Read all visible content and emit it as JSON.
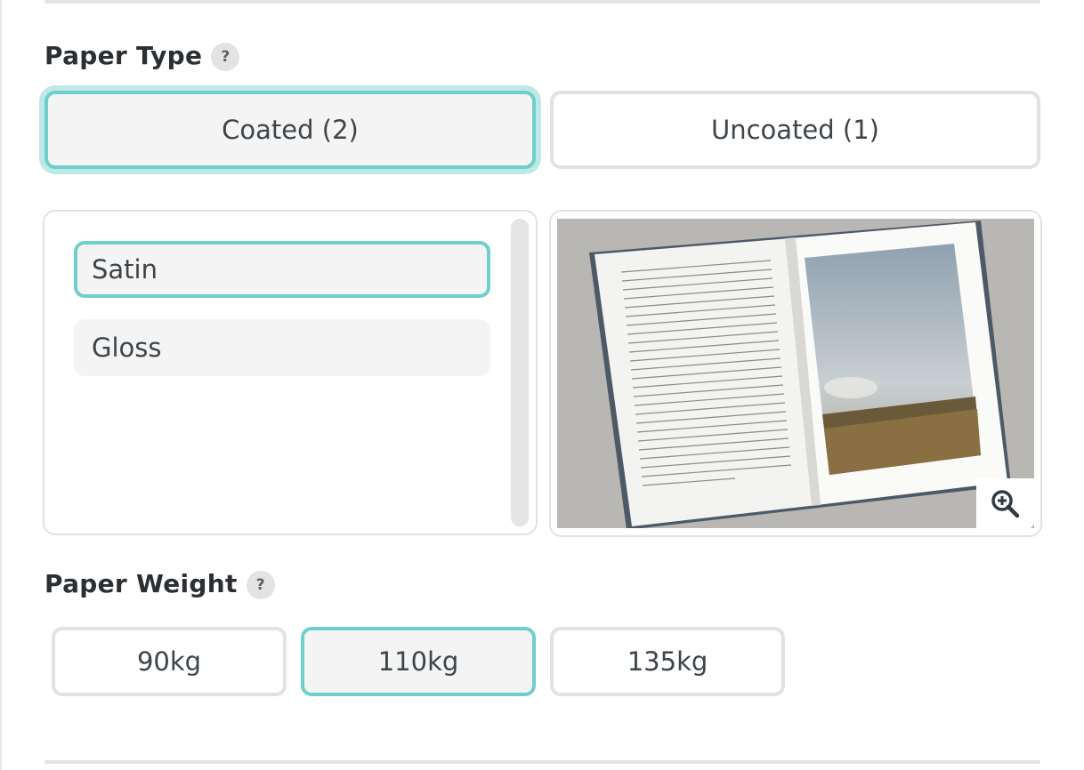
{
  "paper_type": {
    "title": "Paper Type",
    "help": "?",
    "options": [
      {
        "label": "Coated (2)",
        "selected": true
      },
      {
        "label": "Uncoated (1)",
        "selected": false
      }
    ]
  },
  "finishes": {
    "items": [
      {
        "label": "Satin",
        "selected": true
      },
      {
        "label": "Gloss",
        "selected": false
      }
    ]
  },
  "preview": {
    "image": "open-book-photo",
    "zoom_icon": "zoom-in-icon"
  },
  "paper_weight": {
    "title": "Paper Weight",
    "help": "?",
    "options": [
      {
        "label": "90kg",
        "selected": false
      },
      {
        "label": "110kg",
        "selected": true
      },
      {
        "label": "135kg",
        "selected": false
      }
    ]
  },
  "colors": {
    "accent": "#6fd0cb",
    "accent_glow": "#bfe9e6",
    "border": "#e2e2e2",
    "selected_bg": "#f4f4f4"
  }
}
